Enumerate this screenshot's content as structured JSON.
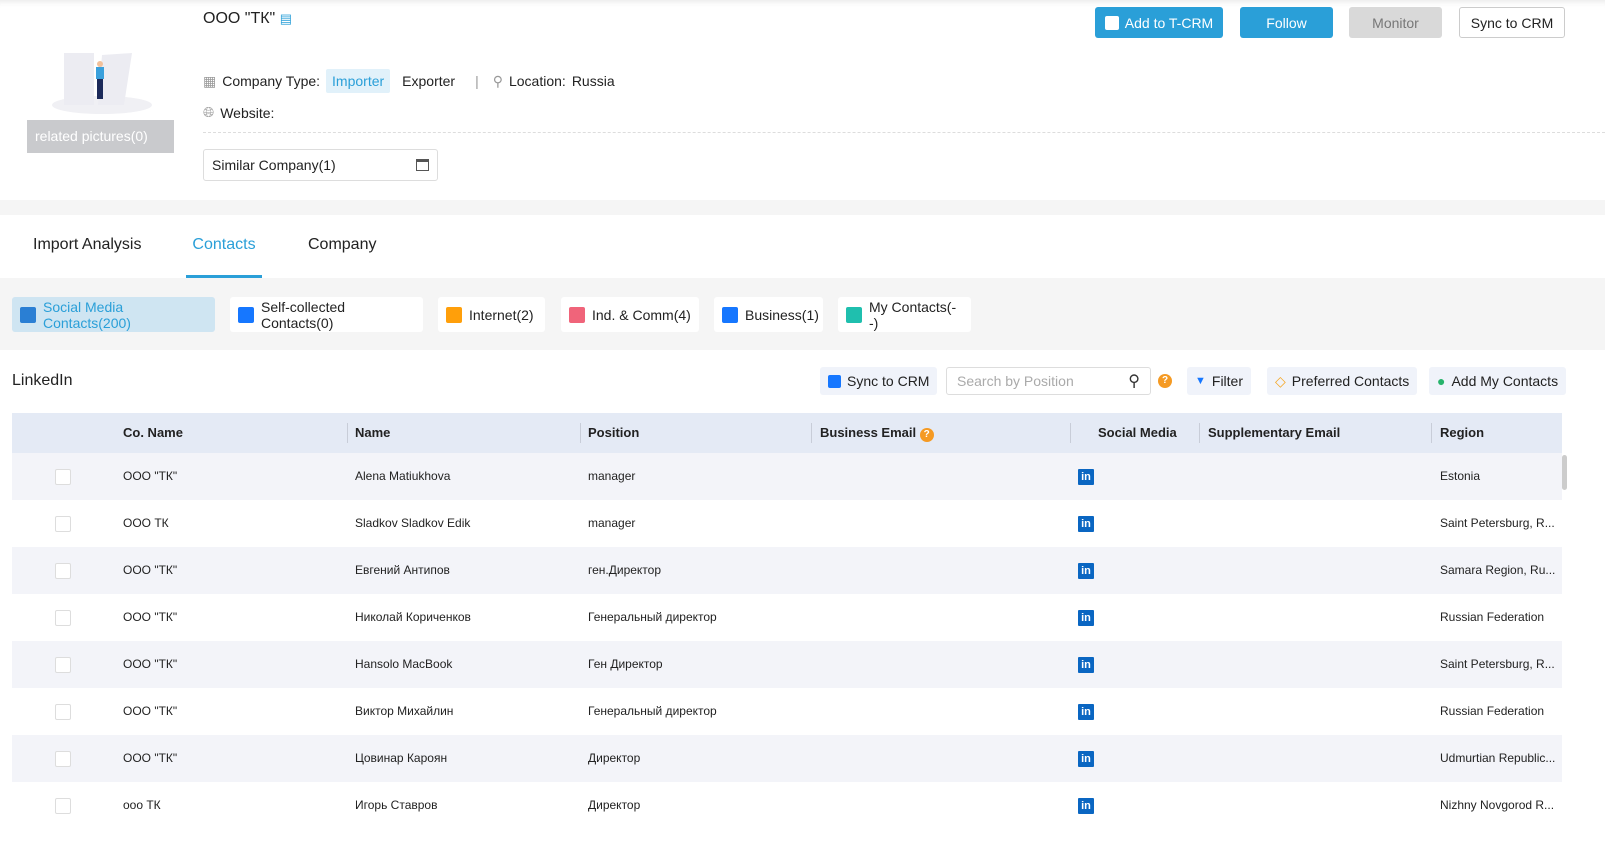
{
  "company": {
    "name": "ООО \"ТК\"",
    "related_pictures": "related pictures(0)",
    "company_type_label": "Company Type:",
    "types": [
      "Importer",
      "Exporter"
    ],
    "location_label": "Location:",
    "location": "Russia",
    "website_label": "Website:",
    "similar": "Similar Company(1)"
  },
  "actions": {
    "add_tcrm": "Add to T-CRM",
    "follow": "Follow",
    "monitor": "Monitor",
    "sync": "Sync to CRM"
  },
  "tabs": [
    "Import Analysis",
    "Contacts",
    "Company"
  ],
  "active_tab": "Contacts",
  "subtabs": [
    {
      "label": "Social Media Contacts(200)",
      "icon": "social-media-icon",
      "color": "#2a7fd4"
    },
    {
      "label": "Self-collected Contacts(0)",
      "icon": "self-collected-icon",
      "color": "#1677ff"
    },
    {
      "label": "Internet(2)",
      "icon": "internet-mail-icon",
      "color": "#ff9f0a"
    },
    {
      "label": "Ind. & Comm(4)",
      "icon": "stamp-icon",
      "color": "#f0647a"
    },
    {
      "label": "Business(1)",
      "icon": "business-chart-icon",
      "color": "#1677ff"
    },
    {
      "label": "My Contacts(--)",
      "icon": "my-contacts-icon",
      "color": "#1fbfae"
    }
  ],
  "section": {
    "title": "LinkedIn",
    "sync": "Sync to CRM",
    "search_placeholder": "Search by Position",
    "filter": "Filter",
    "preferred": "Preferred Contacts",
    "add_my": "Add My Contacts"
  },
  "columns": [
    "Co. Name",
    "Name",
    "Position",
    "Business Email",
    "Social Media",
    "Supplementary Email",
    "Region"
  ],
  "rows": [
    [
      "ООО \"ТК\"",
      "Alena Matiukhova",
      "manager",
      "",
      "",
      "Estonia"
    ],
    [
      "ООО ТК",
      "Sladkov Sladkov Edik",
      "manager",
      "",
      "",
      "Saint Petersburg, R..."
    ],
    [
      "ООО \"ТК\"",
      "Евгений Антипов",
      "ген.Директор",
      "",
      "",
      "Samara Region, Ru..."
    ],
    [
      "ООО \"ТК\"",
      "Николай Кориченков",
      "Генеральный директор",
      "",
      "",
      "Russian Federation"
    ],
    [
      "ООО \"ТК\"",
      "Hansolo MacBook",
      "Ген Директор",
      "",
      "",
      "Saint Petersburg, R..."
    ],
    [
      "ООО \"ТК\"",
      "Виктор Михайлин",
      "Генеральный директор",
      "",
      "",
      "Russian Federation"
    ],
    [
      "ООО \"ТК\"",
      "Цовинар Кароян",
      "Директор",
      "",
      "",
      "Udmurtian Republic..."
    ],
    [
      "ооо ТК",
      "Игорь Ставров",
      "Директор",
      "",
      "",
      "Nizhny Novgorod R..."
    ]
  ],
  "colors": {
    "accent": "#2a9fd8",
    "linkedin": "#0a66c2"
  }
}
